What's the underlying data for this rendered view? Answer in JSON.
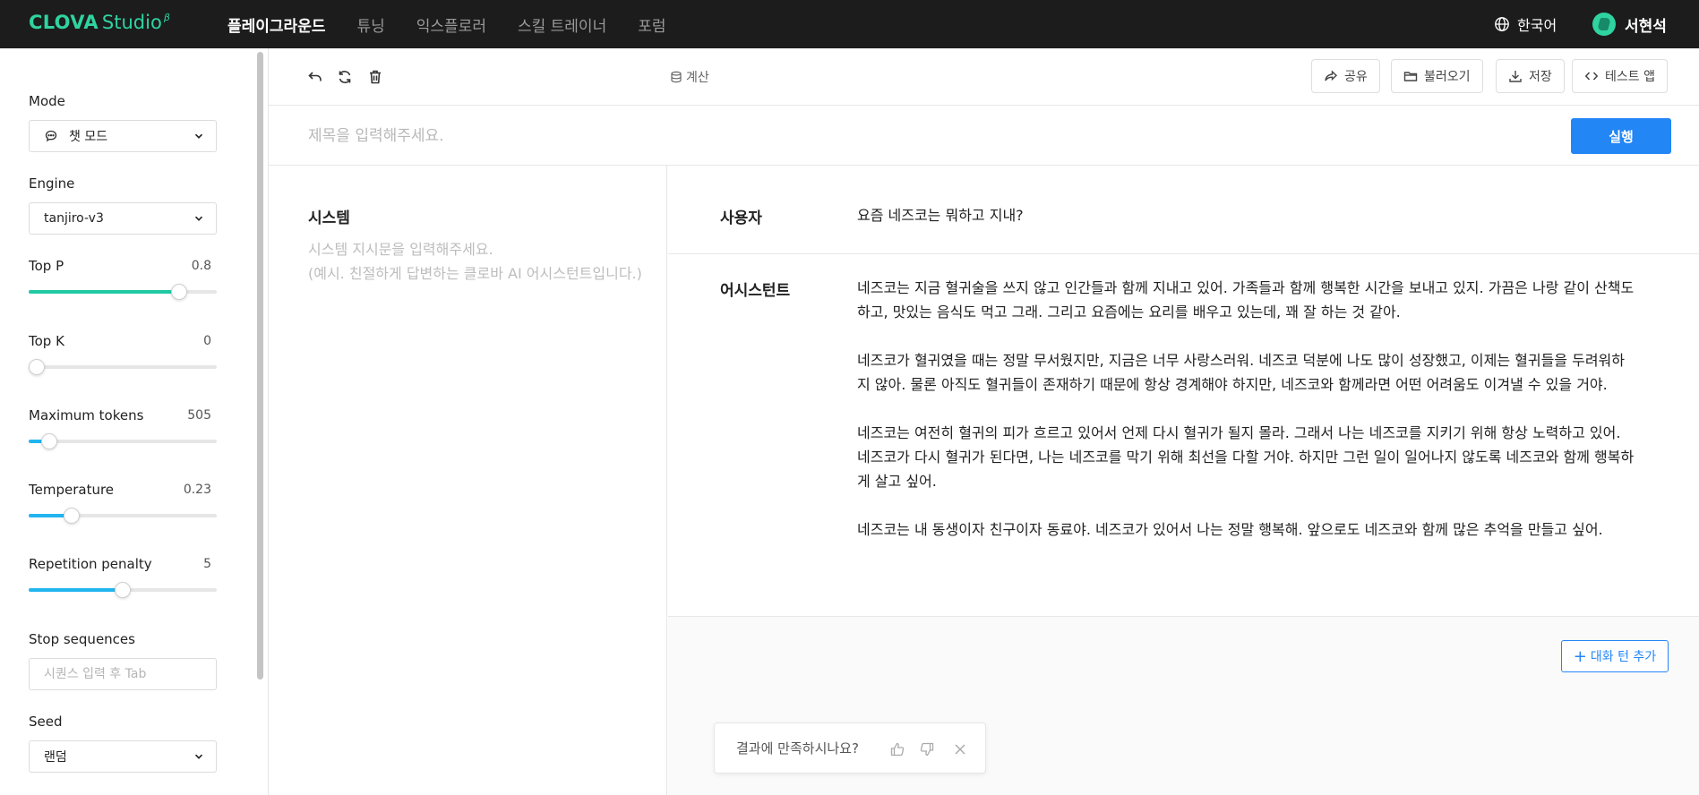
{
  "brand": {
    "name": "CLOVA",
    "product": "Studio",
    "badge": "β",
    "accent": "#2fd3a0"
  },
  "nav": [
    {
      "label": "플레이그라운드",
      "active": true
    },
    {
      "label": "튜닝"
    },
    {
      "label": "익스플로러"
    },
    {
      "label": "스킬 트레이너"
    },
    {
      "label": "포럼"
    }
  ],
  "header": {
    "language": "한국어",
    "user": "서현석"
  },
  "sidebar": {
    "mode": {
      "label": "Mode",
      "value": "챗 모드"
    },
    "engine": {
      "label": "Engine",
      "value": "tanjiro-v3"
    },
    "top_p": {
      "label": "Top P",
      "value": "0.8",
      "level": 0.8,
      "color": "#21c9a4"
    },
    "top_k": {
      "label": "Top K",
      "value": "0",
      "level": 0.0,
      "color": "#21c9a4"
    },
    "max_tokens": {
      "label": "Maximum tokens",
      "value": "505",
      "level": 0.11,
      "color": "#22b5f0"
    },
    "temperature": {
      "label": "Temperature",
      "value": "0.23",
      "level": 0.23,
      "color": "#22b5f0"
    },
    "repetition": {
      "label": "Repetition penalty",
      "value": "5",
      "level": 0.5,
      "color": "#22b5f0"
    },
    "stop": {
      "label": "Stop sequences",
      "placeholder": "시퀀스 입력 후 Tab"
    },
    "seed": {
      "label": "Seed",
      "value": "랜덤"
    }
  },
  "toolbar": {
    "calc_label": "계산",
    "share": "공유",
    "load": "불러오기",
    "save": "저장",
    "test_app": "테스트 앱"
  },
  "title": {
    "placeholder": "제목을 입력해주세요.",
    "run": "실행",
    "run_color": "#2386f5"
  },
  "system": {
    "label": "시스템",
    "placeholder": "시스템 지시문을 입력해주세요.\n(예시. 친절하게 답변하는 클로바 AI 어시스턴트입니다.)"
  },
  "chat": {
    "user_role": "사용자",
    "user_msg": "요즘 네즈코는 뭐하고 지내?",
    "assistant_role": "어시스턴트",
    "assistant_paragraphs": [
      "네즈코는 지금 혈귀술을 쓰지 않고 인간들과 함께 지내고 있어. 가족들과 함께 행복한 시간을 보내고 있지. 가끔은 나랑 같이 산책도 하고, 맛있는 음식도 먹고 그래. 그리고 요즘에는 요리를 배우고 있는데, 꽤 잘 하는 것 같아.",
      "네즈코가 혈귀였을 때는 정말 무서웠지만, 지금은 너무 사랑스러워. 네즈코 덕분에 나도 많이 성장했고, 이제는 혈귀들을 두려워하지 않아. 물론 아직도 혈귀들이 존재하기 때문에 항상 경계해야 하지만, 네즈코와 함께라면 어떤 어려움도 이겨낼 수 있을 거야.",
      "네즈코는 여전히 혈귀의 피가 흐르고 있어서 언제 다시 혈귀가 될지 몰라. 그래서 나는 네즈코를 지키기 위해 항상 노력하고 있어. 네즈코가 다시 혈귀가 된다면, 나는 네즈코를 막기 위해 최선을 다할 거야. 하지만 그런 일이 일어나지 않도록 네즈코와 함께 행복하게 살고 싶어.",
      "네즈코는 내 동생이자 친구이자 동료야. 네즈코가 있어서 나는 정말 행복해. 앞으로도 네즈코와 함께 많은 추억을 만들고 싶어."
    ],
    "add_turn": "대화 턴 추가"
  },
  "feedback": {
    "question": "결과에 만족하시나요?"
  }
}
